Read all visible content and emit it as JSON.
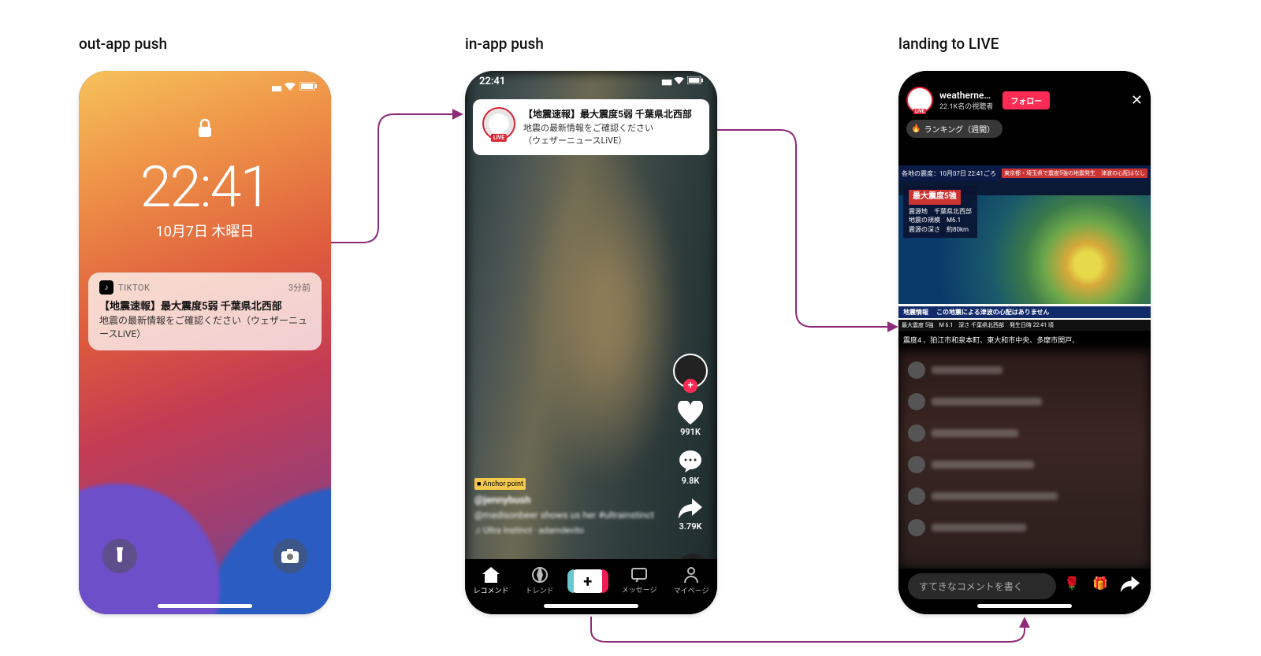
{
  "labels": {
    "out_app": "out-app push",
    "in_app": "in-app push",
    "landing": "landing to LIVE"
  },
  "lockscreen": {
    "time": "22:41",
    "date": "10月7日 木曜日",
    "push": {
      "app_name": "TIKTOK",
      "ago": "3分前",
      "title": "【地震速報】最大震度5弱 千葉県北西部",
      "body": "地震の最新情報をご確認ください（ウェザーニュースLiVE）"
    }
  },
  "feed": {
    "status_time": "22:41",
    "inapp": {
      "title": "【地震速報】最大震度5弱 千葉県北西部",
      "body_line1": "地震の最新情報をご確認ください",
      "body_line2": "（ウェザーニュースLiVE）"
    },
    "right": {
      "likes": "991K",
      "comments": "9.8K",
      "shares": "3.79K"
    },
    "meta": {
      "badge": "Anchor point",
      "user": "@jennybush",
      "caption": "@madisonbeer shows us her #ultrainstinct",
      "music": "♫ Ultra Instinct · adamdevito"
    },
    "tabs": {
      "recommend": "レコメンド",
      "trend": "トレンド",
      "message": "メッセージ",
      "mypage": "マイページ"
    }
  },
  "live": {
    "account": "weatherne…",
    "viewers": "22.1K名の視聴者",
    "follow": "フォロー",
    "ranking": "ランキング（週間）",
    "broadcast": {
      "topbar_left": "各地の震度：10月07日 22:41ごろ",
      "topbar_right": "東京都・埼玉県で震度5強の地震発生　津波の心配はなし",
      "summary_head": "最大震度5強",
      "summary_lines": "震源地　千葉県北西部\n地震の規模　M6.1\n震源の深さ　約80km",
      "band_tag": "地震情報",
      "band_msg": "この地震による津波の心配はありません",
      "subband": "最大震度 5強　M 6.1　深さ 千葉県北西部　発生日時 22:41 頃",
      "scroll": "震度4 、狛江市和泉本町、東大和市中央、多摩市関戸、"
    },
    "comment_placeholder": "すてきなコメントを書く"
  }
}
